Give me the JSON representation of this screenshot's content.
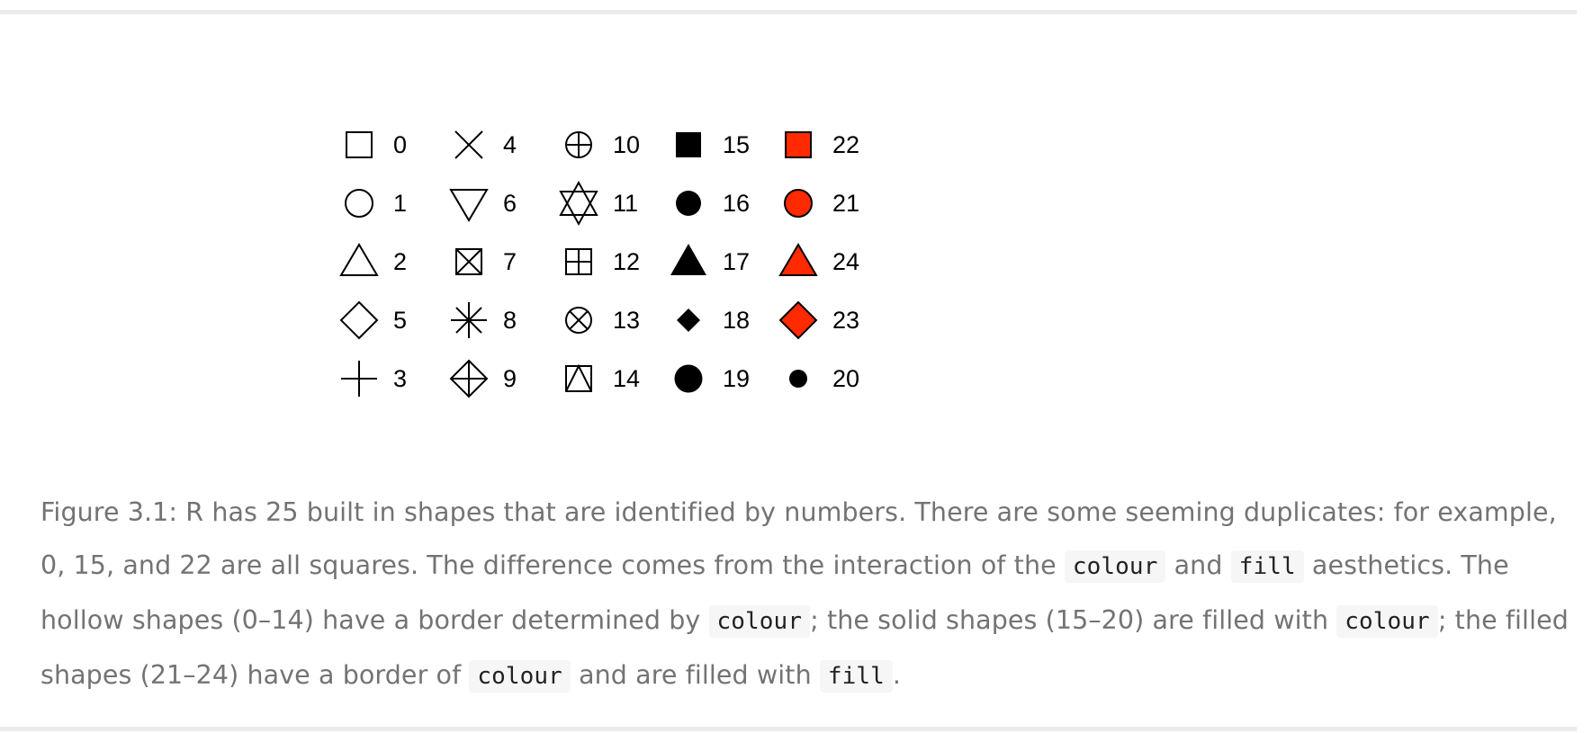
{
  "figure": {
    "columns": [
      [
        {
          "number": "0",
          "shape": "hollow-square",
          "color": "#000000"
        },
        {
          "number": "1",
          "shape": "hollow-circle",
          "color": "#000000"
        },
        {
          "number": "2",
          "shape": "hollow-triangle",
          "color": "#000000"
        },
        {
          "number": "5",
          "shape": "hollow-diamond",
          "color": "#000000"
        },
        {
          "number": "3",
          "shape": "plus",
          "color": "#000000"
        }
      ],
      [
        {
          "number": "4",
          "shape": "cross",
          "color": "#000000"
        },
        {
          "number": "6",
          "shape": "hollow-triangle-down",
          "color": "#000000"
        },
        {
          "number": "7",
          "shape": "square-cross",
          "color": "#000000"
        },
        {
          "number": "8",
          "shape": "asterisk",
          "color": "#000000"
        },
        {
          "number": "9",
          "shape": "diamond-plus",
          "color": "#000000"
        }
      ],
      [
        {
          "number": "10",
          "shape": "circle-plus",
          "color": "#000000"
        },
        {
          "number": "11",
          "shape": "star-of-david",
          "color": "#000000"
        },
        {
          "number": "12",
          "shape": "square-plus",
          "color": "#000000"
        },
        {
          "number": "13",
          "shape": "circle-cross",
          "color": "#000000"
        },
        {
          "number": "14",
          "shape": "square-triangle",
          "color": "#000000"
        }
      ],
      [
        {
          "number": "15",
          "shape": "solid-square",
          "color": "#000000"
        },
        {
          "number": "16",
          "shape": "solid-circle",
          "color": "#000000"
        },
        {
          "number": "17",
          "shape": "solid-triangle",
          "color": "#000000"
        },
        {
          "number": "18",
          "shape": "solid-diamond-small",
          "color": "#000000"
        },
        {
          "number": "19",
          "shape": "solid-circle-large",
          "color": "#000000"
        }
      ],
      [
        {
          "number": "22",
          "shape": "filled-square",
          "color": "#000000",
          "fill": "#ff2a00"
        },
        {
          "number": "21",
          "shape": "filled-circle",
          "color": "#000000",
          "fill": "#ff2a00"
        },
        {
          "number": "24",
          "shape": "filled-triangle",
          "color": "#000000",
          "fill": "#ff2a00"
        },
        {
          "number": "23",
          "shape": "filled-diamond",
          "color": "#000000",
          "fill": "#ff2a00"
        },
        {
          "number": "20",
          "shape": "solid-circle-small",
          "color": "#000000"
        }
      ]
    ]
  },
  "caption": {
    "part1": "Figure 3.1: R has 25 built in shapes that are identified by numbers. There are some seeming duplicates: for example, 0, 15, and 22 are all squares. The difference comes from the interaction of the ",
    "code1": "colour",
    "part2": " and ",
    "code2": "fill",
    "part3": " aesthetics. The hollow shapes (0–14) have a border determined by ",
    "code3": "colour",
    "part4": "; the solid shapes (15–20) are filled with ",
    "code4": "colour",
    "part5": "; the filled shapes (21–24) have a border of ",
    "code5": "colour",
    "part6": " and are filled with ",
    "code6": "fill",
    "part7": "."
  }
}
